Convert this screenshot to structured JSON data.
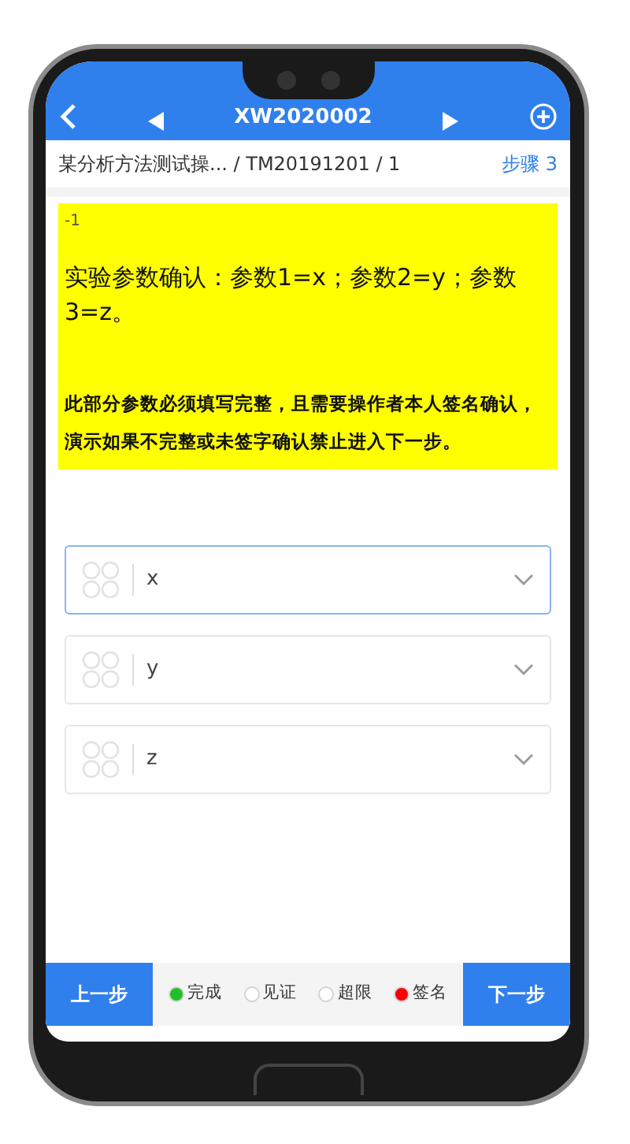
{
  "header": {
    "title": "XW2020002"
  },
  "breadcrumb": {
    "path": "某分析方法测试操... / TM20191201 / 1",
    "step": "步骤 3"
  },
  "instruction": {
    "marker": "-1",
    "heading": "实验参数确认：参数1=x；参数2=y；参数3=z。",
    "note": "此部分参数必须填写完整，且需要操作者本人签名确认，演示如果不完整或未签字确认禁止进入下一步。"
  },
  "fields": [
    {
      "value": "x",
      "focused": true
    },
    {
      "value": "y",
      "focused": false
    },
    {
      "value": "z",
      "focused": false
    }
  ],
  "footer": {
    "prev": "上一步",
    "next": "下一步",
    "legend": [
      {
        "label": "完成",
        "color": "#22c02a"
      },
      {
        "label": "见证",
        "color": "#ffffff"
      },
      {
        "label": "超限",
        "color": "#ffffff"
      },
      {
        "label": "签名",
        "color": "#ff0000"
      }
    ]
  }
}
